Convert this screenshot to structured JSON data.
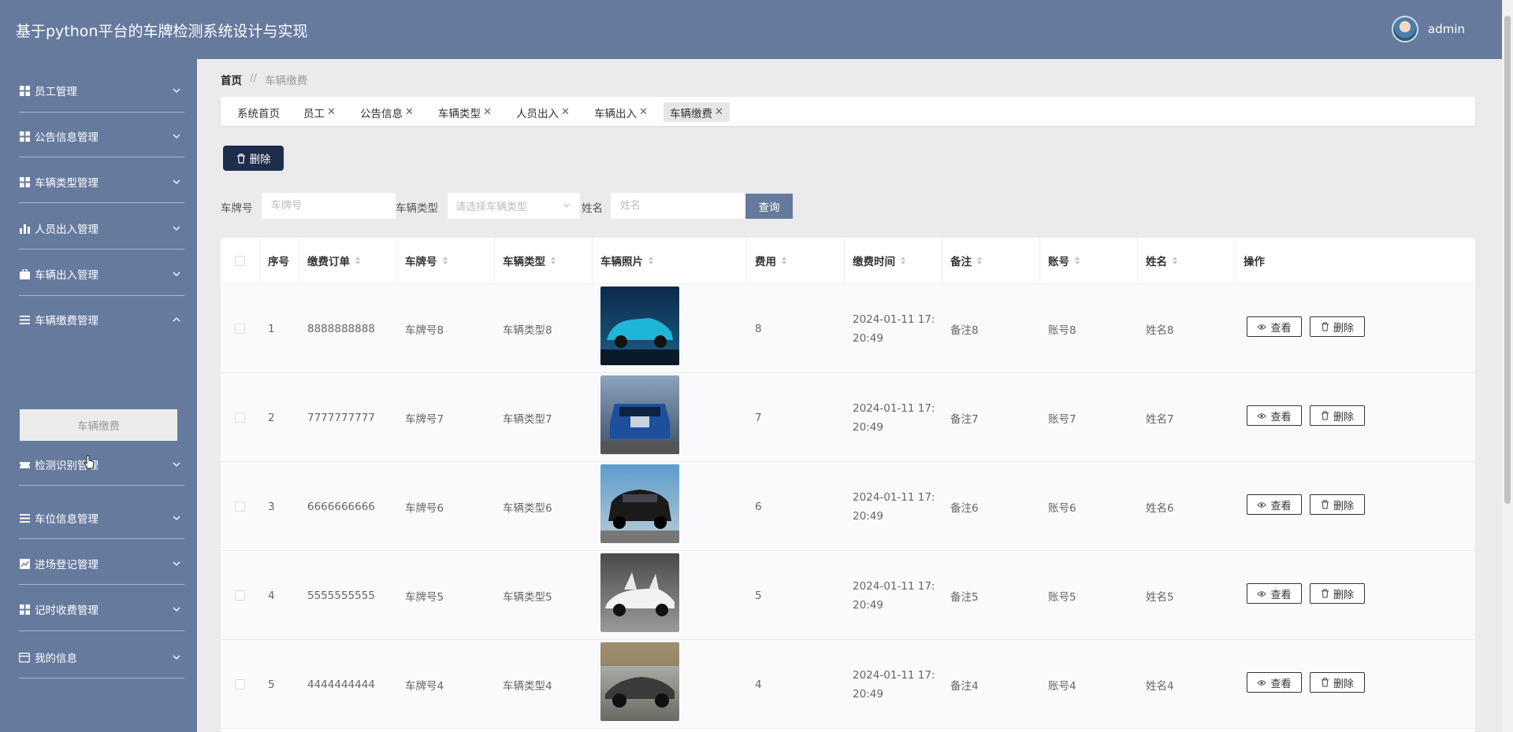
{
  "app": {
    "title": "基于python平台的车牌检测系统设计与实现",
    "username": "admin"
  },
  "sidebar": {
    "items": [
      {
        "label": "员工管理",
        "icon": "grid-icon"
      },
      {
        "label": "公告信息管理",
        "icon": "grid-icon"
      },
      {
        "label": "车辆类型管理",
        "icon": "grid-icon"
      },
      {
        "label": "人员出入管理",
        "icon": "bar-chart-icon"
      },
      {
        "label": "车辆出入管理",
        "icon": "briefcase-icon"
      },
      {
        "label": "车辆缴费管理",
        "icon": "list-icon",
        "expanded": true,
        "children": [
          "车辆缴费"
        ]
      },
      {
        "label": "检测识别管理",
        "icon": "ticket-icon"
      },
      {
        "label": "车位信息管理",
        "icon": "list-icon"
      },
      {
        "label": "进场登记管理",
        "icon": "trend-icon"
      },
      {
        "label": "记时收费管理",
        "icon": "grid-icon"
      },
      {
        "label": "我的信息",
        "icon": "card-icon"
      }
    ]
  },
  "breadcrumb": {
    "home": "首页",
    "separator": "//",
    "current": "车辆缴费"
  },
  "tabs": [
    {
      "label": "系统首页",
      "closable": false
    },
    {
      "label": "员工",
      "closable": true
    },
    {
      "label": "公告信息",
      "closable": true
    },
    {
      "label": "车辆类型",
      "closable": true
    },
    {
      "label": "人员出入",
      "closable": true
    },
    {
      "label": "车辆出入",
      "closable": true
    },
    {
      "label": "车辆缴费",
      "closable": true,
      "active": true
    }
  ],
  "toolbar": {
    "delete_label": "删除"
  },
  "filters": {
    "plate_label": "车牌号",
    "plate_placeholder": "车牌号",
    "type_label": "车辆类型",
    "type_placeholder": "请选择车辆类型",
    "name_label": "姓名",
    "name_placeholder": "姓名",
    "search_label": "查询"
  },
  "table": {
    "columns": [
      "序号",
      "缴费订单",
      "车牌号",
      "车辆类型",
      "车辆照片",
      "费用",
      "缴费时间",
      "备注",
      "账号",
      "姓名",
      "操作"
    ],
    "view_label": "查看",
    "delete_label": "删除",
    "rows": [
      {
        "idx": "1",
        "order": "8888888888",
        "plate": "车牌号8",
        "type": "车辆类型8",
        "fee": "8",
        "time": "2024-01-11 17:20:49",
        "time_l1": "2024-01-11 17:",
        "time_l2": "20:49",
        "note": "备注8",
        "account": "账号8",
        "name": "姓名8",
        "photo": "teal-suv"
      },
      {
        "idx": "2",
        "order": "7777777777",
        "plate": "车牌号7",
        "type": "车辆类型7",
        "fee": "7",
        "time": "2024-01-11 17:20:49",
        "time_l1": "2024-01-11 17:",
        "time_l2": "20:49",
        "note": "备注7",
        "account": "账号7",
        "name": "姓名7",
        "photo": "blue-sedan"
      },
      {
        "idx": "3",
        "order": "6666666666",
        "plate": "车牌号6",
        "type": "车辆类型6",
        "fee": "6",
        "time": "2024-01-11 17:20:49",
        "time_l1": "2024-01-11 17:",
        "time_l2": "20:49",
        "note": "备注6",
        "account": "账号6",
        "name": "姓名6",
        "photo": "black-suv"
      },
      {
        "idx": "4",
        "order": "5555555555",
        "plate": "车牌号5",
        "type": "车辆类型5",
        "fee": "5",
        "time": "2024-01-11 17:20:49",
        "time_l1": "2024-01-11 17:",
        "time_l2": "20:49",
        "note": "备注5",
        "account": "账号5",
        "name": "姓名5",
        "photo": "white-sports"
      },
      {
        "idx": "5",
        "order": "4444444444",
        "plate": "车牌号4",
        "type": "车辆类型4",
        "fee": "4",
        "time": "2024-01-11 17:20:49",
        "time_l1": "2024-01-11 17:",
        "time_l2": "20:49",
        "note": "备注4",
        "account": "账号4",
        "name": "姓名4",
        "photo": "grey-sports"
      }
    ]
  },
  "colors": {
    "primary": "#667a9e",
    "dark_button": "#1f2d4d",
    "separator": "#a9b6cc"
  }
}
